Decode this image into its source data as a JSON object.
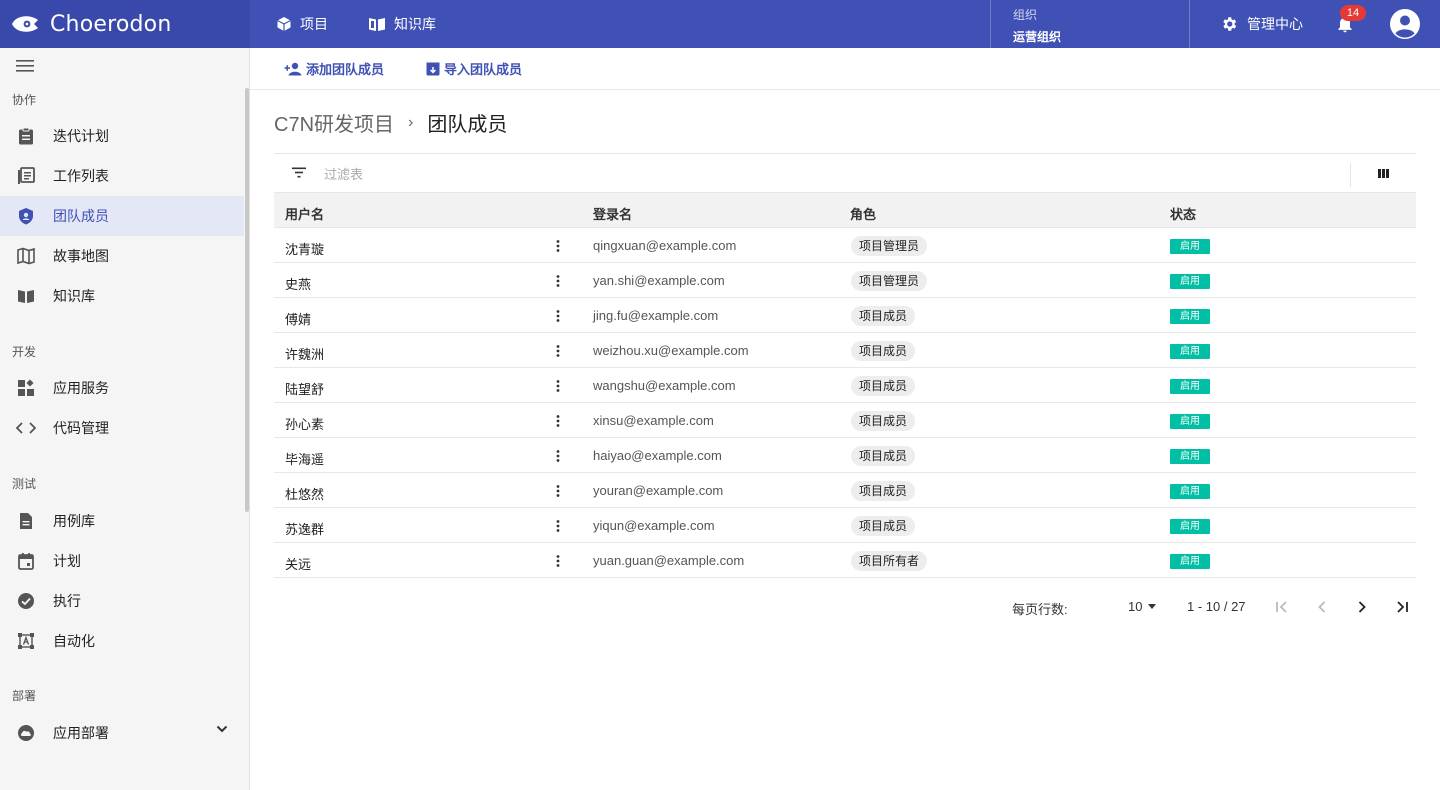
{
  "header": {
    "brand": "Choerodon",
    "nav": [
      {
        "label": "项目"
      },
      {
        "label": "知识库"
      }
    ],
    "org_label": "组织",
    "org_value": "运营组织",
    "admin_label": "管理中心",
    "notification_count": "14"
  },
  "sidebar": {
    "groups": [
      {
        "title": "协作",
        "items": [
          {
            "label": "迭代计划",
            "icon": "clipboard-icon"
          },
          {
            "label": "工作列表",
            "icon": "list-icon"
          },
          {
            "label": "团队成员",
            "icon": "shield-user-icon",
            "active": true
          },
          {
            "label": "故事地图",
            "icon": "map-icon"
          },
          {
            "label": "知识库",
            "icon": "book-icon"
          }
        ]
      },
      {
        "title": "开发",
        "items": [
          {
            "label": "应用服务",
            "icon": "widgets-icon"
          },
          {
            "label": "代码管理",
            "icon": "code-icon"
          }
        ]
      },
      {
        "title": "测试",
        "items": [
          {
            "label": "用例库",
            "icon": "document-icon"
          },
          {
            "label": "计划",
            "icon": "calendar-icon"
          },
          {
            "label": "执行",
            "icon": "check-circle-icon"
          },
          {
            "label": "自动化",
            "icon": "automation-icon"
          }
        ]
      },
      {
        "title": "部署",
        "items": [
          {
            "label": "应用部署",
            "icon": "cloud-icon"
          }
        ]
      }
    ]
  },
  "toolbar": {
    "add_label": "添加团队成员",
    "import_label": "导入团队成员"
  },
  "breadcrumb": {
    "project": "C7N研发项目",
    "separator": "›",
    "current": "团队成员"
  },
  "filter": {
    "placeholder": "过滤表"
  },
  "table": {
    "columns": {
      "name": "用户名",
      "login": "登录名",
      "role": "角色",
      "status": "状态"
    },
    "rows": [
      {
        "name": "沈青璇",
        "login": "qingxuan@example.com",
        "role": "项目管理员",
        "status": "启用"
      },
      {
        "name": "史燕",
        "login": "yan.shi@example.com",
        "role": "项目管理员",
        "status": "启用"
      },
      {
        "name": "傅婧",
        "login": "jing.fu@example.com",
        "role": "项目成员",
        "status": "启用"
      },
      {
        "name": "许魏洲",
        "login": "weizhou.xu@example.com",
        "role": "项目成员",
        "status": "启用"
      },
      {
        "name": "陆望舒",
        "login": "wangshu@example.com",
        "role": "项目成员",
        "status": "启用"
      },
      {
        "name": "孙心素",
        "login": "xinsu@example.com",
        "role": "项目成员",
        "status": "启用"
      },
      {
        "name": "毕海遥",
        "login": "haiyao@example.com",
        "role": "项目成员",
        "status": "启用"
      },
      {
        "name": "杜悠然",
        "login": "youran@example.com",
        "role": "项目成员",
        "status": "启用"
      },
      {
        "name": "苏逸群",
        "login": "yiqun@example.com",
        "role": "项目成员",
        "status": "启用"
      },
      {
        "name": "关远",
        "login": "yuan.guan@example.com",
        "role": "项目所有者",
        "status": "启用"
      }
    ]
  },
  "pagination": {
    "rows_per_page_label": "每页行数:",
    "page_size": "10",
    "range": "1 - 10 / 27"
  },
  "colors": {
    "primary": "#3f51b5",
    "brand_dark": "#3949ab",
    "status_enabled": "#00bfa5",
    "active_bg": "#e3e7f6"
  }
}
